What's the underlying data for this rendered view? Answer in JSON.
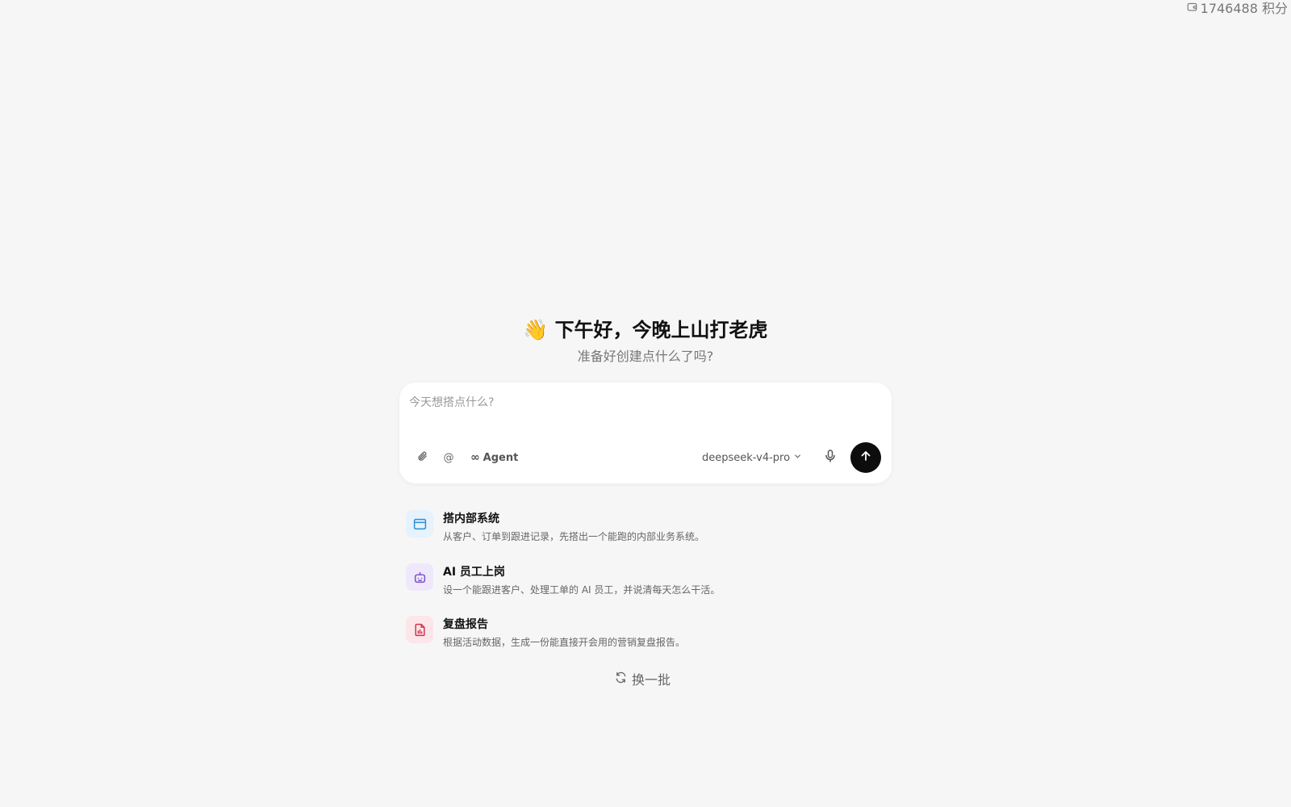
{
  "credits": {
    "icon": "wallet-icon",
    "text": "1746488 积分"
  },
  "hero": {
    "emoji": "👋",
    "greeting": "下午好，今晚上山打老虎",
    "subtitle": "准备好创建点什么了吗?"
  },
  "composer": {
    "placeholder": "今天想搭点什么?",
    "attach_icon": "paperclip-icon",
    "mention_label": "@",
    "agent_label": "Agent",
    "agent_icon": "infinity-icon",
    "model": "deepseek-v4-pro",
    "mic_icon": "microphone-icon",
    "send_icon": "arrow-up-icon"
  },
  "suggestions": [
    {
      "title": "搭内部系统",
      "desc": "从客户、订单到跟进记录，先搭出一个能跑的内部业务系统。",
      "icon": "app-window-icon",
      "color": "#2b8fd6",
      "bg": "#e6f2fc"
    },
    {
      "title": "AI 员工上岗",
      "desc": "设一个能跟进客户、处理工单的 AI 员工，并说清每天怎么干活。",
      "icon": "robot-icon",
      "color": "#7b4ccc",
      "bg": "#efe8fb"
    },
    {
      "title": "复盘报告",
      "desc": "根据活动数据，生成一份能直接开会用的营销复盘报告。",
      "icon": "report-file-icon",
      "color": "#d1354e",
      "bg": "#fce6ea"
    }
  ],
  "refresh_label": "换一批"
}
